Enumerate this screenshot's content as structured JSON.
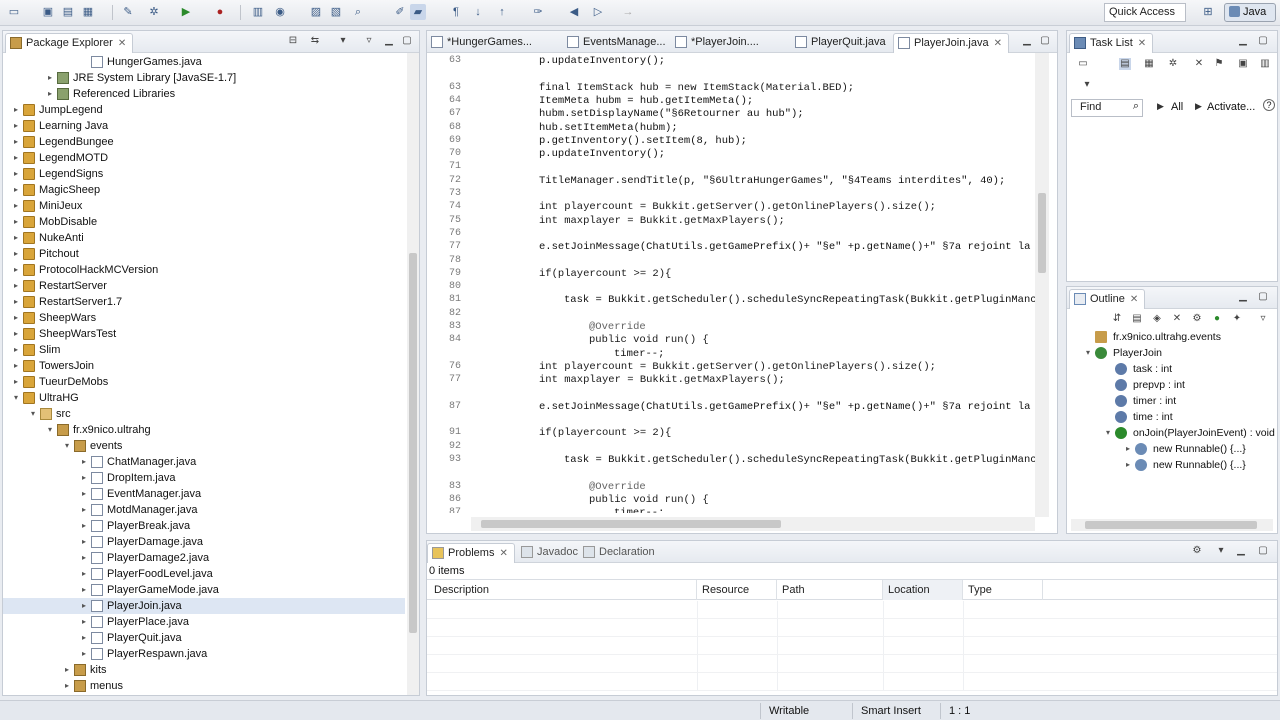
{
  "toolbar": {
    "quick_access": "Quick Access",
    "perspective": "Java"
  },
  "package_explorer": {
    "title": "Package Explorer",
    "tree": [
      {
        "label": "HungerGames.java",
        "kind": "java",
        "depth": 4,
        "twisty": ""
      },
      {
        "label": "JRE System Library [JavaSE-1.7]",
        "kind": "lib",
        "depth": 2,
        "twisty": "▸"
      },
      {
        "label": "Referenced Libraries",
        "kind": "lib",
        "depth": 2,
        "twisty": "▸"
      },
      {
        "label": "JumpLegend",
        "kind": "proj",
        "depth": 0,
        "twisty": "▸"
      },
      {
        "label": "Learning Java",
        "kind": "proj",
        "depth": 0,
        "twisty": "▸"
      },
      {
        "label": "LegendBungee",
        "kind": "proj",
        "depth": 0,
        "twisty": "▸"
      },
      {
        "label": "LegendMOTD",
        "kind": "proj",
        "depth": 0,
        "twisty": "▸"
      },
      {
        "label": "LegendSigns",
        "kind": "proj",
        "depth": 0,
        "twisty": "▸"
      },
      {
        "label": "MagicSheep",
        "kind": "proj",
        "depth": 0,
        "twisty": "▸"
      },
      {
        "label": "MiniJeux",
        "kind": "proj",
        "depth": 0,
        "twisty": "▸"
      },
      {
        "label": "MobDisable",
        "kind": "proj",
        "depth": 0,
        "twisty": "▸"
      },
      {
        "label": "NukeAnti",
        "kind": "proj",
        "depth": 0,
        "twisty": "▸"
      },
      {
        "label": "Pitchout",
        "kind": "proj",
        "depth": 0,
        "twisty": "▸"
      },
      {
        "label": "ProtocolHackMCVersion",
        "kind": "proj",
        "depth": 0,
        "twisty": "▸"
      },
      {
        "label": "RestartServer",
        "kind": "proj",
        "depth": 0,
        "twisty": "▸"
      },
      {
        "label": "RestartServer1.7",
        "kind": "proj",
        "depth": 0,
        "twisty": "▸"
      },
      {
        "label": "SheepWars",
        "kind": "proj",
        "depth": 0,
        "twisty": "▸"
      },
      {
        "label": "SheepWarsTest",
        "kind": "proj",
        "depth": 0,
        "twisty": "▸"
      },
      {
        "label": "Slim",
        "kind": "proj",
        "depth": 0,
        "twisty": "▸"
      },
      {
        "label": "TowersJoin",
        "kind": "proj",
        "depth": 0,
        "twisty": "▸"
      },
      {
        "label": "TueurDeMobs",
        "kind": "proj",
        "depth": 0,
        "twisty": "▸"
      },
      {
        "label": "UltraHG",
        "kind": "proj",
        "depth": 0,
        "twisty": "▾"
      },
      {
        "label": "src",
        "kind": "src",
        "depth": 1,
        "twisty": "▾"
      },
      {
        "label": "fr.x9nico.ultrahg",
        "kind": "pkg",
        "depth": 2,
        "twisty": "▾"
      },
      {
        "label": "events",
        "kind": "pkg",
        "depth": 3,
        "twisty": "▾"
      },
      {
        "label": "ChatManager.java",
        "kind": "java",
        "depth": 4,
        "twisty": "▸"
      },
      {
        "label": "DropItem.java",
        "kind": "java",
        "depth": 4,
        "twisty": "▸"
      },
      {
        "label": "EventManager.java",
        "kind": "java",
        "depth": 4,
        "twisty": "▸"
      },
      {
        "label": "MotdManager.java",
        "kind": "java",
        "depth": 4,
        "twisty": "▸"
      },
      {
        "label": "PlayerBreak.java",
        "kind": "java",
        "depth": 4,
        "twisty": "▸"
      },
      {
        "label": "PlayerDamage.java",
        "kind": "java",
        "depth": 4,
        "twisty": "▸"
      },
      {
        "label": "PlayerDamage2.java",
        "kind": "java",
        "depth": 4,
        "twisty": "▸"
      },
      {
        "label": "PlayerFoodLevel.java",
        "kind": "java",
        "depth": 4,
        "twisty": "▸"
      },
      {
        "label": "PlayerGameMode.java",
        "kind": "java",
        "depth": 4,
        "twisty": "▸"
      },
      {
        "label": "PlayerJoin.java",
        "kind": "java",
        "depth": 4,
        "twisty": "▸",
        "selected": true
      },
      {
        "label": "PlayerPlace.java",
        "kind": "java",
        "depth": 4,
        "twisty": "▸"
      },
      {
        "label": "PlayerQuit.java",
        "kind": "java",
        "depth": 4,
        "twisty": "▸"
      },
      {
        "label": "PlayerRespawn.java",
        "kind": "java",
        "depth": 4,
        "twisty": "▸"
      },
      {
        "label": "kits",
        "kind": "pkg",
        "depth": 3,
        "twisty": "▸"
      },
      {
        "label": "menus",
        "kind": "pkg",
        "depth": 3,
        "twisty": "▸"
      }
    ]
  },
  "editor": {
    "tabs": [
      {
        "label": "*HungerGames...",
        "active": false
      },
      {
        "label": "EventsManage...",
        "active": false
      },
      {
        "label": "*PlayerJoin....",
        "active": false
      },
      {
        "label": "PlayerQuit.java",
        "active": false
      },
      {
        "label": "PlayerJoin.java",
        "active": true
      }
    ],
    "lines": [
      {
        "n": "63",
        "indent": 0,
        "text": "p.updateInventory();"
      },
      {
        "n": "",
        "indent": 0,
        "text": ""
      },
      {
        "n": "63",
        "indent": 0,
        "text": "final ItemStack hub = new ItemStack(Material.BED);"
      },
      {
        "n": "64",
        "indent": 0,
        "text": "ItemMeta hubm = hub.getItemMeta();"
      },
      {
        "n": "67",
        "indent": 0,
        "text": "hubm.setDisplayName(\"§6Retourner au hub\");"
      },
      {
        "n": "68",
        "indent": 0,
        "text": "hub.setItemMeta(hubm);"
      },
      {
        "n": "69",
        "indent": 0,
        "text": "p.getInventory().setItem(8, hub);"
      },
      {
        "n": "70",
        "indent": 0,
        "text": "p.updateInventory();"
      },
      {
        "n": "71",
        "indent": 0,
        "text": ""
      },
      {
        "n": "72",
        "indent": 0,
        "text": "TitleManager.sendTitle(p, \"§6UltraHungerGames\", \"§4Teams interdites\", 40);"
      },
      {
        "n": "73",
        "indent": 0,
        "text": ""
      },
      {
        "n": "74",
        "indent": 0,
        "text": "int playercount = Bukkit.getServer().getOnlinePlayers().size();"
      },
      {
        "n": "75",
        "indent": 0,
        "text": "int maxplayer = Bukkit.getMaxPlayers();"
      },
      {
        "n": "76",
        "indent": 0,
        "text": ""
      },
      {
        "n": "77",
        "indent": 0,
        "text": "e.setJoinMessage(ChatUtils.getGamePrefix()+ \"§e\" +p.getName()+\" §7a rejoint la"
      },
      {
        "n": "78",
        "indent": 0,
        "text": ""
      },
      {
        "n": "79",
        "indent": 0,
        "text": "if(playercount >= 2){"
      },
      {
        "n": "80",
        "indent": 0,
        "text": ""
      },
      {
        "n": "81",
        "indent": 1,
        "text": "task = Bukkit.getScheduler().scheduleSyncRepeatingTask(Bukkit.getPluginManc"
      },
      {
        "n": "82",
        "indent": 0,
        "text": ""
      },
      {
        "n": "83",
        "indent": 2,
        "text": "@Override"
      },
      {
        "n": "84",
        "indent": 2,
        "text": "public void run() {"
      },
      {
        "n": "",
        "indent": 3,
        "text": "timer--;"
      },
      {
        "n": "76",
        "indent": 0,
        "text": "int playercount = Bukkit.getServer().getOnlinePlayers().size();"
      },
      {
        "n": "77",
        "indent": 0,
        "text": "int maxplayer = Bukkit.getMaxPlayers();"
      },
      {
        "n": "",
        "indent": 0,
        "text": ""
      },
      {
        "n": "87",
        "indent": 0,
        "text": "e.setJoinMessage(ChatUtils.getGamePrefix()+ \"§e\" +p.getName()+\" §7a rejoint la"
      },
      {
        "n": "",
        "indent": 0,
        "text": ""
      },
      {
        "n": "91",
        "indent": 0,
        "text": "if(playercount >= 2){"
      },
      {
        "n": "92",
        "indent": 0,
        "text": ""
      },
      {
        "n": "93",
        "indent": 1,
        "text": "task = Bukkit.getScheduler().scheduleSyncRepeatingTask(Bukkit.getPluginManc"
      },
      {
        "n": "",
        "indent": 0,
        "text": ""
      },
      {
        "n": "83",
        "indent": 2,
        "text": "@Override"
      },
      {
        "n": "86",
        "indent": 2,
        "text": "public void run() {"
      },
      {
        "n": "87",
        "indent": 3,
        "text": "timer--;"
      }
    ]
  },
  "task_list": {
    "title": "Task List",
    "find_placeholder": "Find",
    "all_label": "All",
    "activate_label": "Activate..."
  },
  "outline": {
    "title": "Outline",
    "items": [
      {
        "label": "fr.x9nico.ultrahg.events",
        "depth": 0,
        "twisty": "",
        "icon": "package"
      },
      {
        "label": "PlayerJoin",
        "depth": 0,
        "twisty": "▾",
        "icon": "class"
      },
      {
        "label": "task : int",
        "depth": 1,
        "twisty": "",
        "icon": "field"
      },
      {
        "label": "prepvp : int",
        "depth": 1,
        "twisty": "",
        "icon": "field"
      },
      {
        "label": "timer : int",
        "depth": 1,
        "twisty": "",
        "icon": "field"
      },
      {
        "label": "time : int",
        "depth": 1,
        "twisty": "",
        "icon": "field"
      },
      {
        "label": "onJoin(PlayerJoinEvent) : void",
        "depth": 1,
        "twisty": "▾",
        "icon": "method"
      },
      {
        "label": "new Runnable() {...}",
        "depth": 2,
        "twisty": "▸",
        "icon": "anon"
      },
      {
        "label": "new Runnable() {...}",
        "depth": 2,
        "twisty": "▸",
        "icon": "anon"
      }
    ]
  },
  "problems": {
    "tabs": [
      {
        "label": "Problems",
        "active": true
      },
      {
        "label": "Javadoc",
        "active": false
      },
      {
        "label": "Declaration",
        "active": false
      }
    ],
    "count": "0 items",
    "columns": [
      "Description",
      "Resource",
      "Path",
      "Location",
      "Type"
    ]
  },
  "statusbar": {
    "writable": "Writable",
    "insert_mode": "Smart Insert",
    "position": "1 : 1"
  },
  "colors": {
    "keyword": "#7f0055",
    "string": "#2a00ff",
    "annotation": "#646464",
    "accent": "#3b5b86"
  }
}
